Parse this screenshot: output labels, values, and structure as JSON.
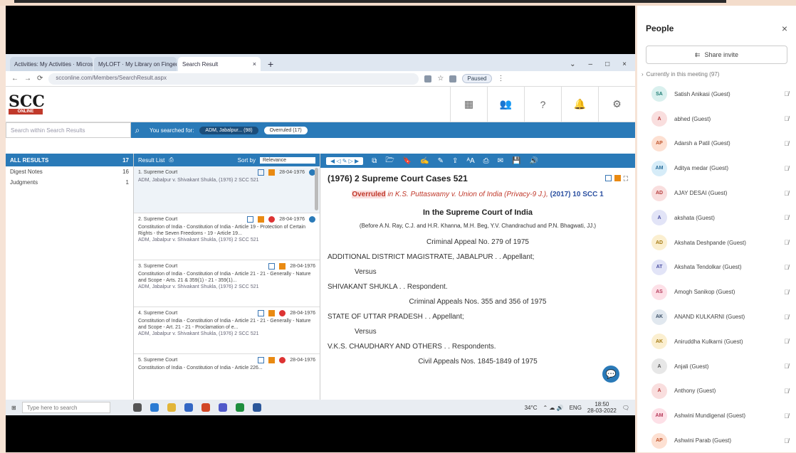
{
  "browser": {
    "tabs": [
      {
        "label": "Activities: My Activities · Micros",
        "active": false
      },
      {
        "label": "MyLOFT · My Library on Finger",
        "active": false
      },
      {
        "label": "Search Result",
        "active": true
      }
    ],
    "url": "scconline.com/Members/SearchResult.aspx",
    "paused_label": "Paused"
  },
  "app": {
    "logo": "SCC",
    "logo_sub": "ONLINE",
    "search_placeholder": "Search within Search Results",
    "searched_for_label": "You searched for:",
    "chip1": "ADM, Jabalpur... (98)",
    "chip2": "Overruled (17)"
  },
  "left": {
    "all_results": "ALL RESULTS",
    "all_count": "17",
    "facets": [
      {
        "label": "Digest Notes",
        "count": "16"
      },
      {
        "label": "Judgments",
        "count": "1"
      }
    ]
  },
  "list": {
    "header": "Result List",
    "sort_by": "Sort by",
    "sort_value": "Relevance",
    "results": [
      {
        "num": "1. Supreme Court",
        "date": "28-04-1976",
        "desc": "",
        "cite": "ADM, Jabalpur v. Shivakant Shukla, (1976) 2 SCC 521"
      },
      {
        "num": "2. Supreme Court",
        "date": "28-04-1976",
        "desc": "Constitution of India - Constitution of India - Article 19 - Protection of Certain Rights - the Seven Freedoms - 19 - Article 19...",
        "cite": "ADM, Jabalpur v. Shivakant Shukla, (1976) 2 SCC 521"
      },
      {
        "num": "3. Supreme Court",
        "date": "28-04-1976",
        "desc": "Constitution of India - Constitution of India - Article 21 - 21 - Generally - Nature and Scope - Arts. 21 & 359(1) - 21 - 359(1)...",
        "cite": "ADM, Jabalpur v. Shivakant Shukla, (1976) 2 SCC 521"
      },
      {
        "num": "4. Supreme Court",
        "date": "28-04-1976",
        "desc": "Constitution of India - Constitution of India - Article 21 - 21 - Generally - Nature and Scope - Art. 21 - 21 - Proclamation of e...",
        "cite": "ADM, Jabalpur v. Shivakant Shukla, (1976) 2 SCC 521"
      },
      {
        "num": "5. Supreme Court",
        "date": "28-04-1976",
        "desc": "Constitution of India - Constitution of India - Article 226...",
        "cite": ""
      }
    ]
  },
  "doc": {
    "title": "(1976) 2 Supreme Court Cases 521",
    "overruled_word": "Overruled",
    "overruled_in": "in K.S. Puttaswamy v. Union of India (Privacy-9 J.),",
    "overruled_cite": "(2017) 10 SCC 1",
    "court": "In the Supreme Court of India",
    "bench": "(Before A.N. Ray, C.J. and H.R. Khanna, M.H. Beg, Y.V. Chandrachud and P.N. Bhagwati, JJ.)",
    "lines": [
      "Criminal Appeal No. 279 of 1975",
      "ADDITIONAL DISTRICT MAGISTRATE, JABALPUR . . Appellant;",
      "Versus",
      "SHIVAKANT SHUKLA . . Respondent.",
      "Criminal Appeals Nos. 355 and 356 of 1975",
      "STATE OF UTTAR PRADESH . . Appellant;",
      "Versus",
      "V.K.S. CHAUDHARY AND OTHERS . . Respondents.",
      "Civil Appeals Nos. 1845-1849 of 1975"
    ]
  },
  "taskbar": {
    "search_placeholder": "Type here to search",
    "weather": "34°C",
    "time": "18:50",
    "date": "28-03-2022",
    "lang": "ENG"
  },
  "people": {
    "title": "People",
    "share": "Share invite",
    "in_meeting": "Currently in this meeting (97)",
    "list": [
      {
        "initials": "SA",
        "name": "Satish Anikasi (Guest)",
        "bg": "#d9f0ee",
        "fg": "#1e7d74"
      },
      {
        "initials": "A",
        "name": "abhed (Guest)",
        "bg": "#f9dede",
        "fg": "#b53a3a"
      },
      {
        "initials": "AP",
        "name": "Adarsh a Patil (Guest)",
        "bg": "#fde0d2",
        "fg": "#c0532a"
      },
      {
        "initials": "AM",
        "name": "Aditya medar (Guest)",
        "bg": "#d6ecf8",
        "fg": "#2a6e9a"
      },
      {
        "initials": "AD",
        "name": "AJAY DESAI (Guest)",
        "bg": "#f9dede",
        "fg": "#b53a3a"
      },
      {
        "initials": "A",
        "name": "akshata (Guest)",
        "bg": "#e2e4f7",
        "fg": "#4a4fa0"
      },
      {
        "initials": "AD",
        "name": "Akshata Deshpande (Guest)",
        "bg": "#fbefd0",
        "fg": "#a57a12"
      },
      {
        "initials": "AT",
        "name": "Akshata Tendolkar (Guest)",
        "bg": "#e2e4f7",
        "fg": "#4a4fa0"
      },
      {
        "initials": "AS",
        "name": "Amogh Sanikop (Guest)",
        "bg": "#fde0e7",
        "fg": "#b53a5a"
      },
      {
        "initials": "AK",
        "name": "ANAND KULKARNI (Guest)",
        "bg": "#e1e8ef",
        "fg": "#3a4f66"
      },
      {
        "initials": "AK",
        "name": "Aniruddha Kulkarni (Guest)",
        "bg": "#fbefd0",
        "fg": "#a57a12"
      },
      {
        "initials": "A",
        "name": "Anjali (Guest)",
        "bg": "#e7e7e7",
        "fg": "#555555"
      },
      {
        "initials": "A",
        "name": "Anthony (Guest)",
        "bg": "#f9dede",
        "fg": "#b53a3a"
      },
      {
        "initials": "AM",
        "name": "Ashwini Mundigenal (Guest)",
        "bg": "#fde0e7",
        "fg": "#b53a5a"
      },
      {
        "initials": "AP",
        "name": "Ashwini Parab (Guest)",
        "bg": "#fde0d2",
        "fg": "#c0532a"
      }
    ]
  }
}
